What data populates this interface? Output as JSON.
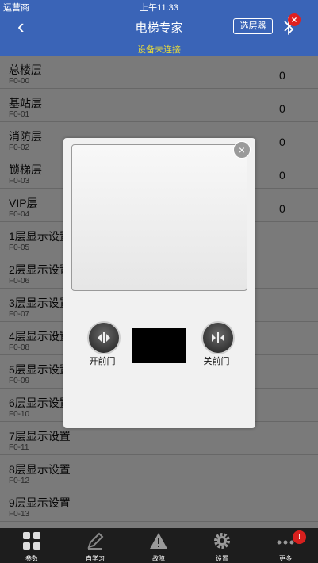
{
  "status_bar": {
    "carrier": "运营商",
    "time": "上午11:33"
  },
  "nav": {
    "title": "电梯专家",
    "subtitle": "设备未连接",
    "select_button": "选层器",
    "back_icon": "chevron-left-icon",
    "bluetooth_icon": "bluetooth-icon",
    "error_icon": "error-x-icon"
  },
  "list": {
    "rows": [
      {
        "name": "总楼层",
        "code": "F0-00",
        "value": "0"
      },
      {
        "name": "基站层",
        "code": "F0-01",
        "value": "0"
      },
      {
        "name": "消防层",
        "code": "F0-02",
        "value": "0"
      },
      {
        "name": "锁梯层",
        "code": "F0-03",
        "value": "0"
      },
      {
        "name": "VIP层",
        "code": "F0-04",
        "value": "0"
      },
      {
        "name": "1层显示设置",
        "code": "F0-05",
        "value": ""
      },
      {
        "name": "2层显示设置",
        "code": "F0-06",
        "value": ""
      },
      {
        "name": "3层显示设置",
        "code": "F0-07",
        "value": ""
      },
      {
        "name": "4层显示设置",
        "code": "F0-08",
        "value": ""
      },
      {
        "name": "5层显示设置",
        "code": "F0-09",
        "value": ""
      },
      {
        "name": "6层显示设置",
        "code": "F0-10",
        "value": ""
      },
      {
        "name": "7层显示设置",
        "code": "F0-11",
        "value": ""
      },
      {
        "name": "8层显示设置",
        "code": "F0-12",
        "value": ""
      },
      {
        "name": "9层显示设置",
        "code": "F0-13",
        "value": ""
      }
    ]
  },
  "dialog": {
    "open_door_label": "开前门",
    "close_door_label": "关前门",
    "close_icon": "close-icon"
  },
  "tabbar": {
    "tabs": [
      {
        "label": "参数",
        "icon": "grid-icon"
      },
      {
        "label": "自学习",
        "icon": "pencil-icon"
      },
      {
        "label": "故障",
        "icon": "warning-icon"
      },
      {
        "label": "设置",
        "icon": "gear-icon"
      },
      {
        "label": "更多",
        "icon": "more-dots-icon"
      }
    ],
    "more_badge": "!"
  },
  "colors": {
    "nav_bg": "#3a64b7",
    "subtitle": "#e6d93c",
    "tabbar_bg": "#1d1d1d",
    "badge": "#d8201e"
  }
}
